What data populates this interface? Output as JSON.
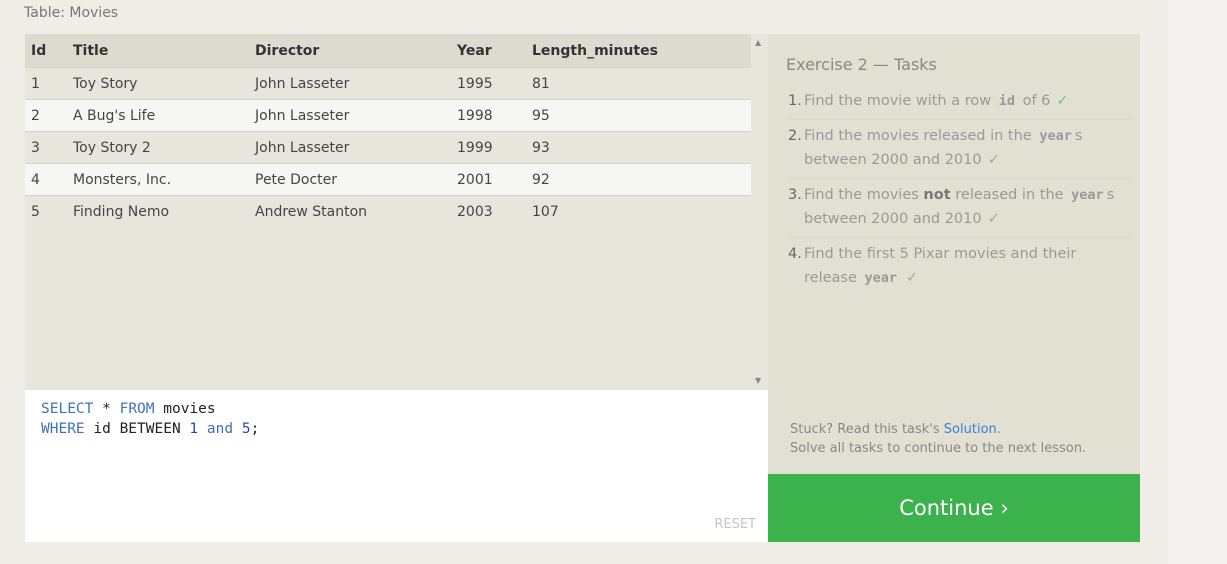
{
  "table": {
    "caption": "Table: Movies",
    "columns": [
      "Id",
      "Title",
      "Director",
      "Year",
      "Length_minutes"
    ],
    "rows": [
      [
        "1",
        "Toy Story",
        "John Lasseter",
        "1995",
        "81"
      ],
      [
        "2",
        "A Bug's Life",
        "John Lasseter",
        "1998",
        "95"
      ],
      [
        "3",
        "Toy Story 2",
        "John Lasseter",
        "1999",
        "93"
      ],
      [
        "4",
        "Monsters, Inc.",
        "Pete Docter",
        "2001",
        "92"
      ],
      [
        "5",
        "Finding Nemo",
        "Andrew Stanton",
        "2003",
        "107"
      ]
    ]
  },
  "scrollbar": {
    "up_icon": "triangle-up",
    "down_icon": "triangle-down"
  },
  "editor": {
    "line1": {
      "kw1": "SELECT",
      "star": " * ",
      "kw2": "FROM",
      "rest": " movies"
    },
    "line2": {
      "kw1": "WHERE",
      "mid": " id BETWEEN ",
      "n1": "1",
      "sp1": " ",
      "kw2": "and",
      "sp2": " ",
      "n2": "5",
      "end": ";"
    },
    "reset_label": "RESET"
  },
  "exercise": {
    "title": "Exercise 2 — Tasks",
    "check_mark": "✓",
    "tasks": [
      {
        "num": "1.",
        "pre": "Find the movie with a row ",
        "code": "id",
        "post": " of 6"
      },
      {
        "num": "2.",
        "pre": "Find the movies released in the ",
        "code": "year",
        "post": "s between 2000 and 2010"
      },
      {
        "num": "3.",
        "pre": "Find the movies ",
        "bold": "not",
        "mid": " released in the ",
        "code": "year",
        "post": "s between 2000 and 2010"
      },
      {
        "num": "4.",
        "pre": "Find the first 5 Pixar movies and their release ",
        "code": "year",
        "post": ""
      }
    ],
    "stuck_pre": "Stuck? Read this task's ",
    "solution_link": "Solution",
    "stuck_post": ".",
    "solve_all": "Solve all tasks to continue to the next lesson."
  },
  "continue_label": "Continue ›",
  "colors": {
    "accent_green": "#3cb24c",
    "keyword_blue": "#3d72b8",
    "link_blue": "#3a7ed0"
  }
}
